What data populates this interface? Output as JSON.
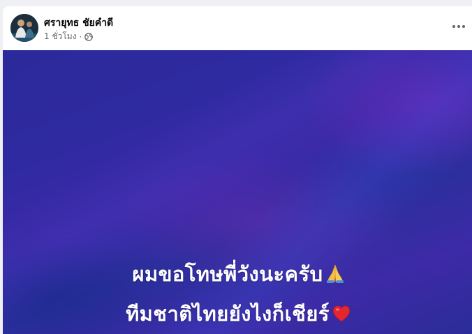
{
  "post": {
    "author": "ศรายุทธ ชัยคำดี",
    "time": "1 ชั่วโมง",
    "separator": "·",
    "privacy_icon": "globe-icon",
    "more_icon": "more-options-icon",
    "background_colors": [
      "#2b2a9a",
      "#3b2aa8",
      "#2a2c98"
    ],
    "text_line_1": "ผมขอโทษพี่วังนะครับ",
    "text_line_1_emoji": "pray-icon",
    "text_line_2": "ทีมชาติไทยยังไงก็เชียร์",
    "text_line_2_emoji": "heart-icon"
  }
}
